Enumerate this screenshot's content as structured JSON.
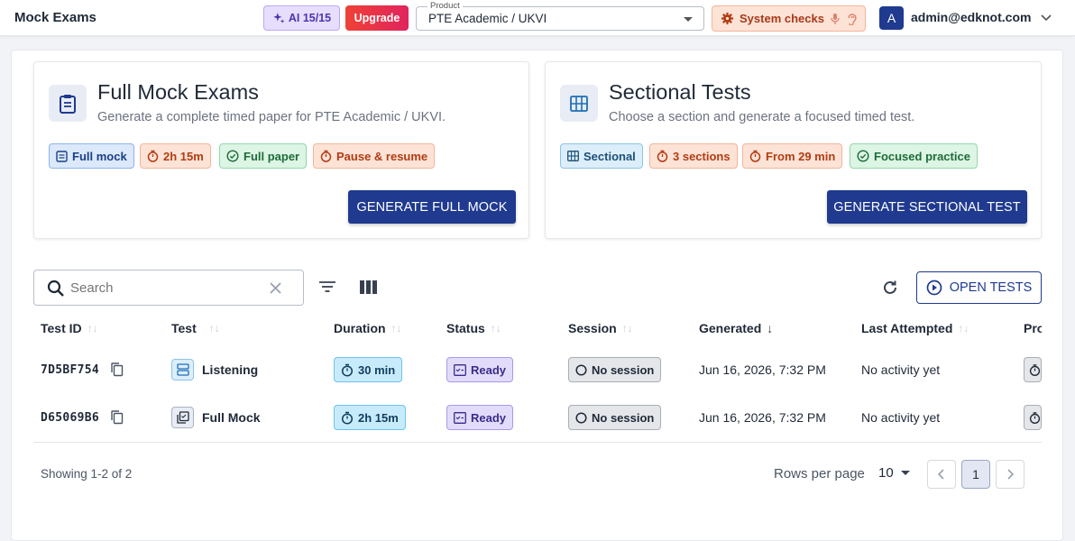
{
  "header": {
    "title": "Mock Exams",
    "ai_badge": "AI 15/15",
    "upgrade": "Upgrade",
    "product_label": "Product",
    "product_value": "PTE Academic / UKVI",
    "system_checks": "System checks",
    "avatar_initial": "A",
    "user_email": "admin@edknot.com"
  },
  "cards": {
    "full": {
      "title": "Full Mock Exams",
      "subtitle": "Generate a complete timed paper for PTE Academic / UKVI.",
      "chips": [
        "Full mock",
        "2h 15m",
        "Full paper",
        "Pause & resume"
      ],
      "button": "GENERATE FULL MOCK"
    },
    "sectional": {
      "title": "Sectional Tests",
      "subtitle": "Choose a section and generate a focused timed test.",
      "chips": [
        "Sectional",
        "3 sections",
        "From 29 min",
        "Focused practice"
      ],
      "button": "GENERATE SECTIONAL TEST"
    }
  },
  "toolbar": {
    "search_placeholder": "Search",
    "open_tests": "OPEN TESTS"
  },
  "table": {
    "headers": [
      "Test ID",
      "Test",
      "Duration",
      "Status",
      "Session",
      "Generated",
      "Last Attempted",
      "Pro"
    ],
    "rows": [
      {
        "id": "7D5BF754",
        "test": "Listening",
        "duration": "30 min",
        "status": "Ready",
        "session": "No session",
        "generated": "Jun 16, 2026, 7:32 PM",
        "last_attempted": "No activity yet"
      },
      {
        "id": "D65069B6",
        "test": "Full Mock",
        "duration": "2h 15m",
        "status": "Ready",
        "session": "No session",
        "generated": "Jun 16, 2026, 7:32 PM",
        "last_attempted": "No activity yet"
      }
    ]
  },
  "footer": {
    "showing": "Showing 1-2 of 2",
    "rows_per_page_label": "Rows per page",
    "rows_per_page_value": "10",
    "current_page": "1"
  },
  "colors": {
    "primary": "#1f3a8f",
    "upgrade_gradient": [
      "#ef4136",
      "#e0245e"
    ],
    "ai_badge_bg": "#e6defc",
    "system_checks_bg": "#fde3d6"
  },
  "icons": [
    "sparkle-icon",
    "gear-icon",
    "mic-icon",
    "ear-icon",
    "chevron-down-icon",
    "clipboard-icon",
    "grid-icon",
    "timer-icon",
    "check-circle-icon",
    "search-icon",
    "clear-icon",
    "filter-icon",
    "columns-icon",
    "refresh-icon",
    "play-circle-icon",
    "copy-icon",
    "sort-icon",
    "sort-desc-icon",
    "chevron-left-icon",
    "chevron-right-icon"
  ]
}
